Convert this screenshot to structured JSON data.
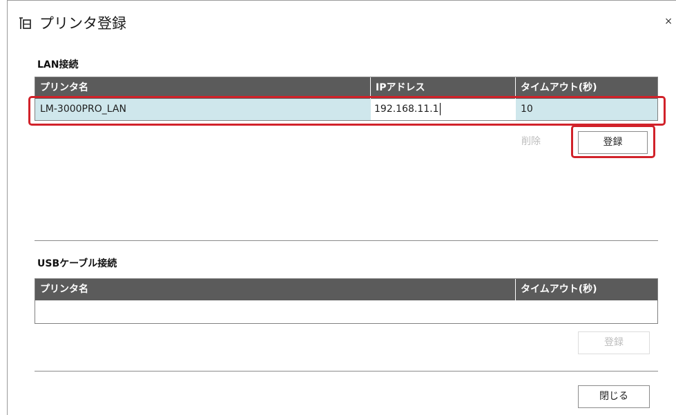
{
  "window": {
    "title": "プリンタ登録",
    "close_label": "×"
  },
  "lan": {
    "section_label": "LAN接続",
    "columns": [
      "プリンタ名",
      "IPアドレス",
      "タイムアウト(秒)"
    ],
    "row": {
      "printer_name": "LM-3000PRO_LAN",
      "ip_address": "192.168.11.1",
      "timeout": "10"
    },
    "delete_label": "削除",
    "register_label": "登録"
  },
  "usb": {
    "section_label": "USBケーブル接続",
    "columns": [
      "プリンタ名",
      "タイムアウト(秒)"
    ],
    "register_label": "登録"
  },
  "footer": {
    "close_button_label": "閉じる"
  },
  "colors": {
    "header_bg": "#5b5b5b",
    "selected_row_bg": "#cfe7ec",
    "highlight": "#d1222a"
  }
}
